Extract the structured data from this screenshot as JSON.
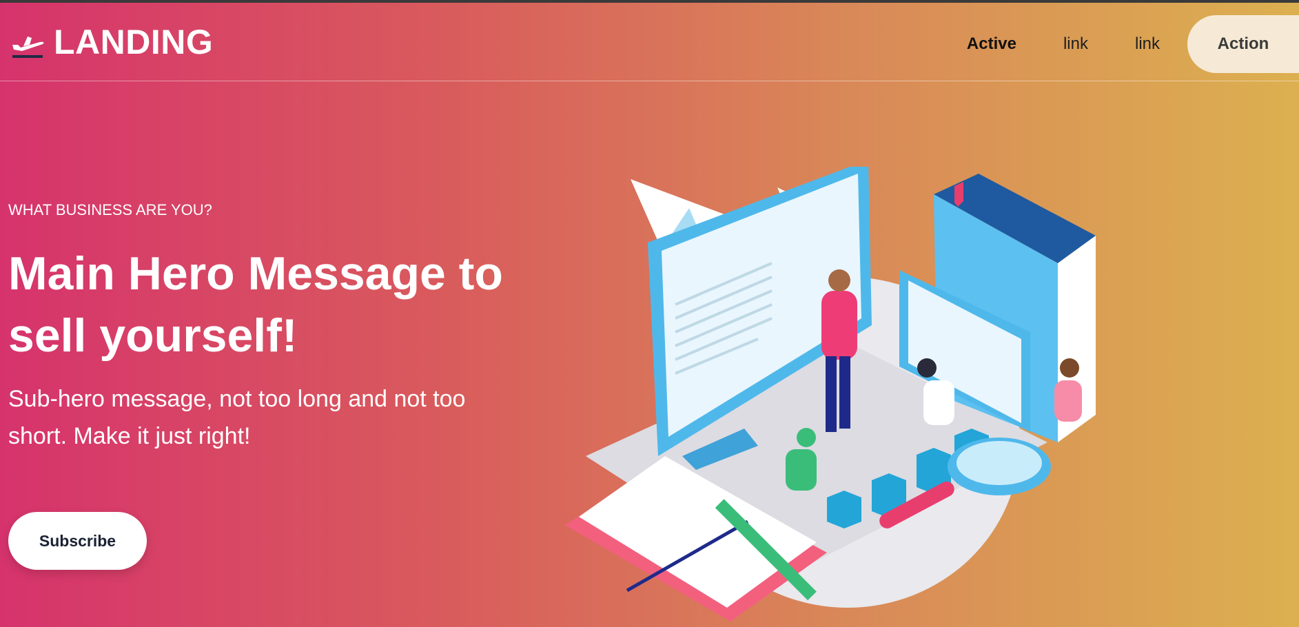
{
  "nav": {
    "logo_icon": "plane-icon",
    "logo_text": "LANDING",
    "links": [
      {
        "label": "Active",
        "active": true
      },
      {
        "label": "link",
        "active": false
      },
      {
        "label": "link",
        "active": false
      }
    ],
    "action_label": "Action"
  },
  "hero": {
    "eyebrow": "WHAT BUSINESS ARE YOU?",
    "title": "Main Hero Message to sell yourself!",
    "subtitle": "Sub-hero message, not too long and not too short. Make it just right!",
    "button_label": "Subscribe"
  },
  "colors": {
    "gradient_start": "#d6336c",
    "gradient_end": "#dcb050",
    "action_bg": "#f6ead6",
    "text_light": "#ffffff"
  }
}
